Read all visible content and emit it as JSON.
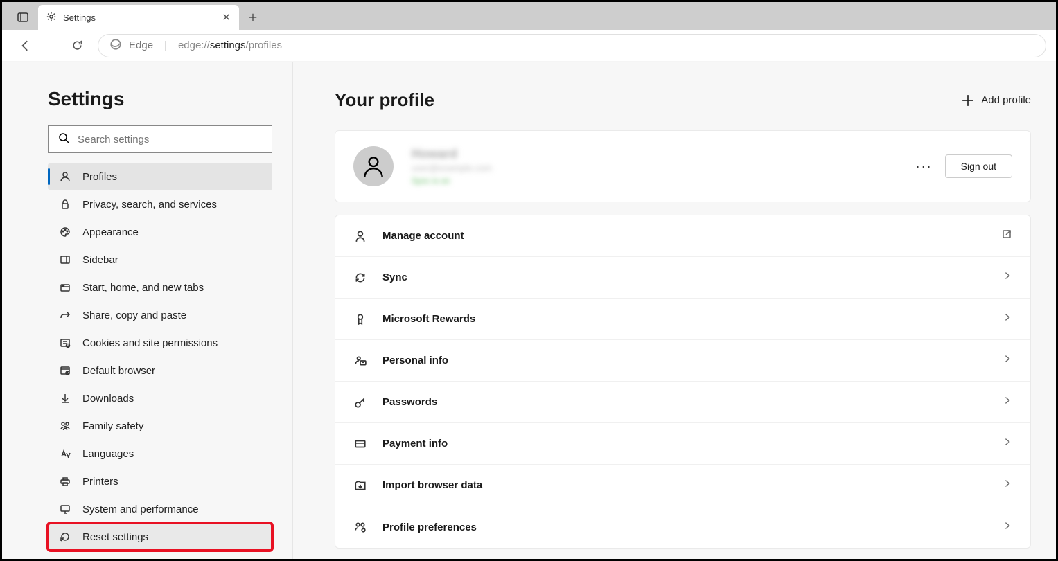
{
  "tab": {
    "title": "Settings"
  },
  "address": {
    "label": "Edge",
    "prefix": "edge://",
    "bold": "settings",
    "suffix": "/profiles"
  },
  "sidebar": {
    "title": "Settings",
    "search_placeholder": "Search settings",
    "items": [
      {
        "label": "Profiles",
        "icon": "profile"
      },
      {
        "label": "Privacy, search, and services",
        "icon": "lock"
      },
      {
        "label": "Appearance",
        "icon": "palette"
      },
      {
        "label": "Sidebar",
        "icon": "sidebar"
      },
      {
        "label": "Start, home, and new tabs",
        "icon": "tabs"
      },
      {
        "label": "Share, copy and paste",
        "icon": "share"
      },
      {
        "label": "Cookies and site permissions",
        "icon": "cookies"
      },
      {
        "label": "Default browser",
        "icon": "browser"
      },
      {
        "label": "Downloads",
        "icon": "download"
      },
      {
        "label": "Family safety",
        "icon": "family"
      },
      {
        "label": "Languages",
        "icon": "language"
      },
      {
        "label": "Printers",
        "icon": "printer"
      },
      {
        "label": "System and performance",
        "icon": "system"
      },
      {
        "label": "Reset settings",
        "icon": "reset"
      }
    ]
  },
  "main": {
    "title": "Your profile",
    "add_profile": "Add profile",
    "profile": {
      "name": "Howard",
      "email": "user@example.com",
      "status": "Sync is on"
    },
    "more": "···",
    "signout": "Sign out",
    "items": [
      {
        "label": "Manage account",
        "icon": "person",
        "action": "external"
      },
      {
        "label": "Sync",
        "icon": "sync",
        "action": "chevron"
      },
      {
        "label": "Microsoft Rewards",
        "icon": "rewards",
        "action": "chevron"
      },
      {
        "label": "Personal info",
        "icon": "personal",
        "action": "chevron"
      },
      {
        "label": "Passwords",
        "icon": "key",
        "action": "chevron"
      },
      {
        "label": "Payment info",
        "icon": "card",
        "action": "chevron"
      },
      {
        "label": "Import browser data",
        "icon": "import",
        "action": "chevron"
      },
      {
        "label": "Profile preferences",
        "icon": "prefs",
        "action": "chevron"
      }
    ]
  }
}
